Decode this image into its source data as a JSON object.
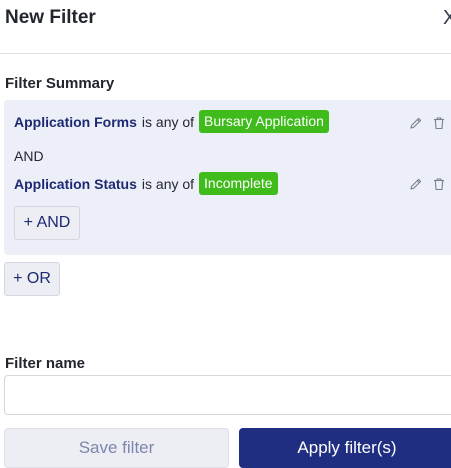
{
  "header": {
    "title": "New Filter",
    "close_glyph": "X"
  },
  "summary": {
    "label": "Filter Summary",
    "conditions": [
      {
        "field": "Application Forms",
        "operator": "is any of",
        "value": "Bursary Application"
      },
      {
        "field": "Application Status",
        "operator": "is any of",
        "value": "Incomplete"
      }
    ],
    "joiner": "AND",
    "add_and_label": "+ AND"
  },
  "add_or_label": "+ OR",
  "filter_name": {
    "label": "Filter name",
    "value": "",
    "placeholder": ""
  },
  "actions": {
    "save_label": "Save filter",
    "apply_label": "Apply filter(s)"
  },
  "colors": {
    "chip": "#3fbb1c",
    "primary": "#1f2e80",
    "field_text": "#1d2a72",
    "summary_bg": "#eceef8"
  },
  "icons": {
    "edit": "pencil-icon",
    "delete": "trash-icon",
    "close": "close-icon"
  }
}
